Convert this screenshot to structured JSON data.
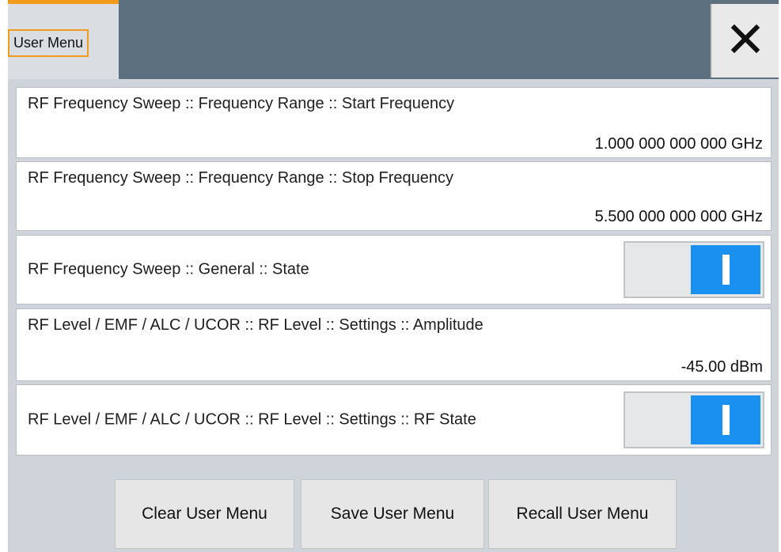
{
  "window": {
    "tab_label": "User Menu",
    "close_icon": "close-icon",
    "accent_color": "#f29a19",
    "toggle_color": "#1a91f0"
  },
  "entries": [
    {
      "label": "RF Frequency Sweep :: Frequency Range :: Start Frequency",
      "value": "1.000 000 000 000 GHz"
    },
    {
      "label": "RF Frequency Sweep :: Frequency Range :: Stop Frequency",
      "value": "5.500 000 000 000 GHz"
    },
    {
      "label": "RF Frequency Sweep :: General :: State",
      "state": "on"
    },
    {
      "label": "RF Level / EMF / ALC / UCOR :: RF Level :: Settings :: Amplitude",
      "value": "-45.00 dBm"
    },
    {
      "label": "RF Level / EMF / ALC / UCOR :: RF Level :: Settings :: RF State",
      "state": "on"
    }
  ],
  "buttons": {
    "clear": "Clear User Menu",
    "save": "Save User Menu",
    "recall": "Recall User Menu"
  }
}
